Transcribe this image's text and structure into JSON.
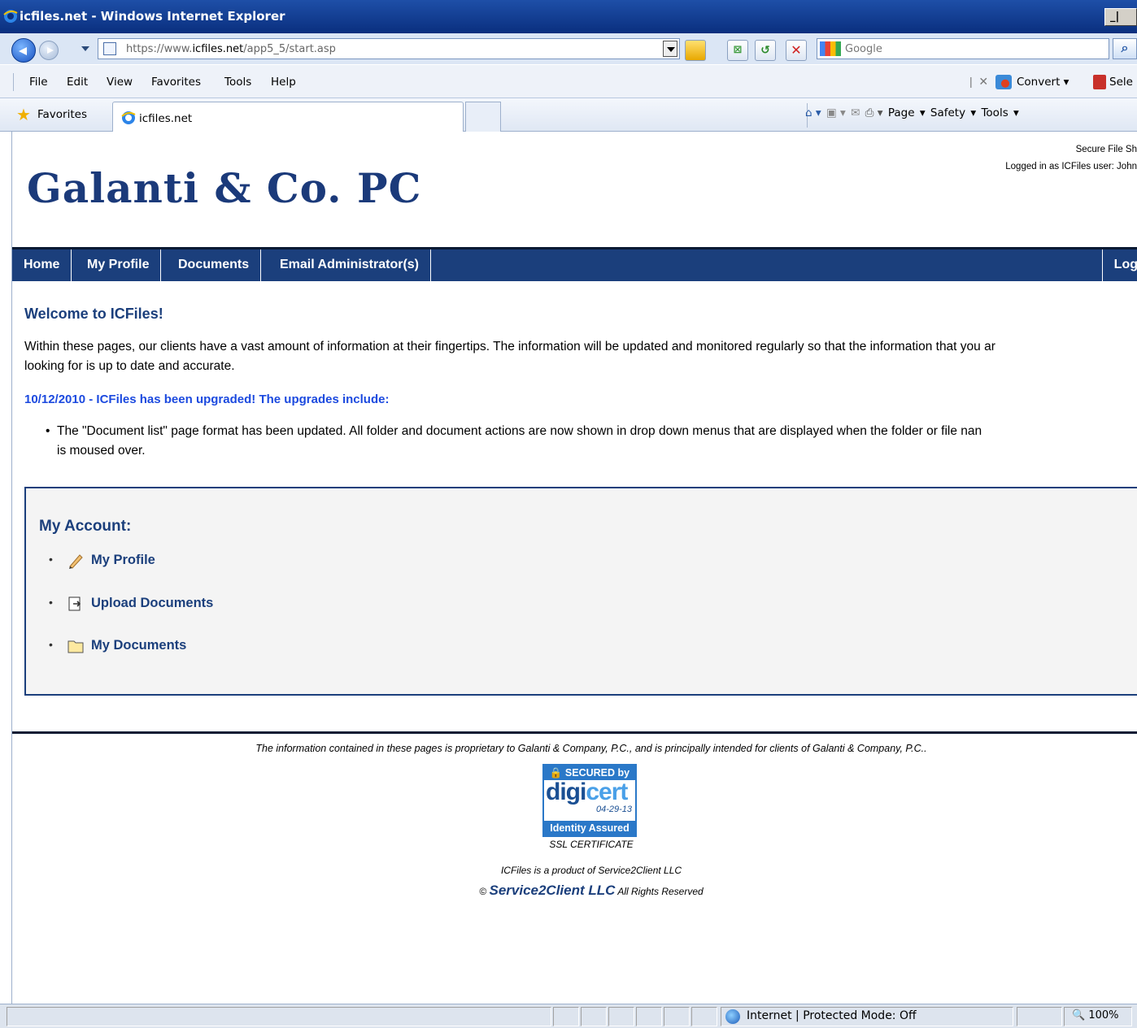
{
  "window": {
    "title": "icfiles.net - Windows Internet Explorer"
  },
  "address_bar": {
    "url_prefix": "https://www.",
    "url_domain": "icfiles.net",
    "url_path": "/app5_5/start.asp"
  },
  "search": {
    "placeholder": "Google"
  },
  "menu": {
    "items": [
      "File",
      "Edit",
      "View",
      "Favorites",
      "Tools",
      "Help"
    ],
    "convert_label": "Convert",
    "select_label": "Sele"
  },
  "favorites_bar": {
    "favorites_label": "Favorites",
    "tab_title": "icfiles.net"
  },
  "command_bar": {
    "page_label": "Page",
    "safety_label": "Safety",
    "tools_label": "Tools"
  },
  "header": {
    "top_line": "Secure File Sh",
    "logged_in": "Logged in as ICFiles user: John",
    "brand": "Galanti & Co. PC"
  },
  "nav": {
    "items": [
      "Home",
      "My Profile",
      "Documents",
      "Email Administrator(s)"
    ],
    "logout": "Log"
  },
  "main": {
    "welcome": "Welcome to ICFiles!",
    "intro_line1": "Within these pages, our clients have a vast amount of information at their fingertips. The information will be updated and monitored regularly so that the information that you ar",
    "intro_line2": "looking for is up to date and accurate.",
    "upgrade_heading": "10/12/2010 - ICFiles has been upgraded! The upgrades include:",
    "bullet_line1": "The \"Document list\" page format has been updated. All folder and document actions are now shown in drop down menus that are displayed when the folder or file nan",
    "bullet_line2": "is moused over."
  },
  "account": {
    "heading": "My Account:",
    "items": [
      {
        "label": "My Profile",
        "icon": "pencil-icon"
      },
      {
        "label": "Upload Documents",
        "icon": "upload-icon"
      },
      {
        "label": "My Documents",
        "icon": "folder-icon"
      }
    ]
  },
  "footer": {
    "notice": "The information contained in these pages is proprietary to Galanti & Company, P.C., and is principally intended for clients of Galanti & Company, P.C..",
    "seal_top": "SECURED by",
    "seal_brand_a": "digi",
    "seal_brand_b": "cert",
    "seal_date": "04-29-13",
    "seal_bottom": "Identity Assured",
    "ssl": "SSL CERTIFICATE",
    "product": "ICFiles is a product of Service2Client LLC",
    "copy_symbol": "©",
    "copy_company": "Service2Client LLC",
    "copy_rest": "All Rights Reserved"
  },
  "status_bar": {
    "zone": "Internet | Protected Mode: Off",
    "zoom": "100%"
  }
}
